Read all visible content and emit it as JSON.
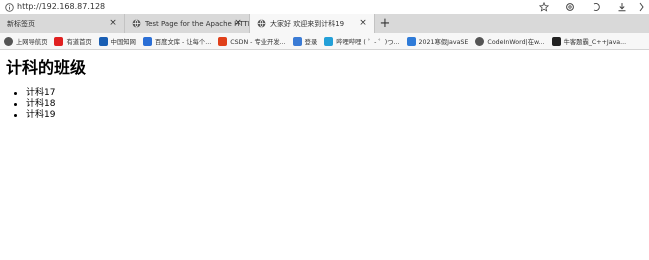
{
  "browser": {
    "url": "http://192.168.87.128",
    "tabs": [
      {
        "label": "新标签页",
        "active": false
      },
      {
        "label": "Test Page for the Apache HTTP",
        "active": false
      },
      {
        "label": "大家好 欢迎来到计科19",
        "active": true
      }
    ],
    "new_tab_label": "+",
    "close_label": "×",
    "bookmarks": [
      {
        "label": "上网导航页",
        "icon": "globe-icon",
        "color": "#555555"
      },
      {
        "label": "有道首页",
        "icon": "youdao-icon",
        "color": "#e02020"
      },
      {
        "label": "中国知网",
        "icon": "cnki-icon",
        "color": "#1a5fb4"
      },
      {
        "label": "百度文库 - 让每个...",
        "icon": "paw-icon",
        "color": "#2b6fd6"
      },
      {
        "label": "CSDN - 专业开发...",
        "icon": "csdn-icon",
        "color": "#e0401a"
      },
      {
        "label": "登录",
        "icon": "login-icon",
        "color": "#3a7bd5"
      },
      {
        "label": "哔哩哔哩 ( ゜- ゜)つ...",
        "icon": "tv-icon",
        "color": "#23a0d8"
      },
      {
        "label": "2021寒假JavaSE",
        "icon": "dash-icon",
        "color": "#2f7bd8"
      },
      {
        "label": "CodeInWord|在w...",
        "icon": "globe-icon",
        "color": "#555555"
      },
      {
        "label": "牛客题霸_C++Java...",
        "icon": "nowcoder-icon",
        "color": "#222222"
      }
    ]
  },
  "page": {
    "title": "计科的班级",
    "classes": [
      "计科17",
      "计科18",
      "计科19"
    ]
  }
}
